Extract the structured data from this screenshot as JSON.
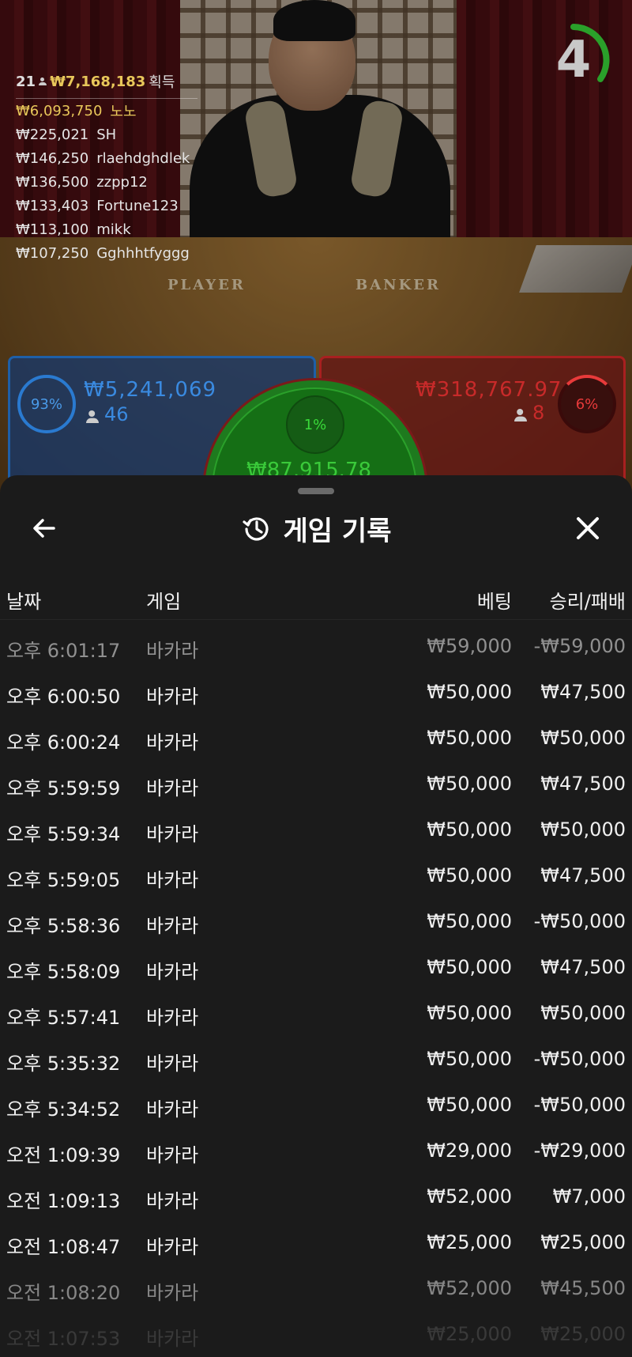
{
  "live": {
    "leaderboard": {
      "count": "21",
      "total": "₩7,168,183",
      "won_label": "획득",
      "entries": [
        {
          "amount": "₩6,093,750",
          "name": "노노"
        },
        {
          "amount": "₩225,021",
          "name": "SH"
        },
        {
          "amount": "₩146,250",
          "name": "rlaehdghdlek"
        },
        {
          "amount": "₩136,500",
          "name": "zzpp12"
        },
        {
          "amount": "₩133,403",
          "name": "Fortune123"
        },
        {
          "amount": "₩113,100",
          "name": "mikk"
        },
        {
          "amount": "₩107,250",
          "name": "Gghhhtfyggg"
        }
      ]
    },
    "timer": "4",
    "table_labels": {
      "player": "PLAYER",
      "banker": "BANKER"
    },
    "bets": {
      "player": {
        "percent": "93%",
        "amount": "₩5,241,069",
        "players": "46"
      },
      "banker": {
        "percent": "6%",
        "amount": "₩318,767.97",
        "players": "8"
      },
      "tie": {
        "percent": "1%",
        "amount": "₩87,915.78"
      }
    },
    "colors": {
      "player": "#1e5fa8",
      "banker": "#a82020",
      "tie": "#1e7a1e",
      "gold": "#e8c75a"
    }
  },
  "sheet": {
    "title": "게임 기록",
    "icons": {
      "back": "arrow-left-icon",
      "history": "history-icon",
      "close": "close-icon"
    },
    "columns": {
      "date": "날짜",
      "game": "게임",
      "bet": "베팅",
      "result": "승리/패배"
    },
    "rows": [
      {
        "date": "오후 6:01:17",
        "game": "바카라",
        "bet": "₩59,000",
        "result": "-₩59,000"
      },
      {
        "date": "오후 6:00:50",
        "game": "바카라",
        "bet": "₩50,000",
        "result": "₩47,500"
      },
      {
        "date": "오후 6:00:24",
        "game": "바카라",
        "bet": "₩50,000",
        "result": "₩50,000"
      },
      {
        "date": "오후 5:59:59",
        "game": "바카라",
        "bet": "₩50,000",
        "result": "₩47,500"
      },
      {
        "date": "오후 5:59:34",
        "game": "바카라",
        "bet": "₩50,000",
        "result": "₩50,000"
      },
      {
        "date": "오후 5:59:05",
        "game": "바카라",
        "bet": "₩50,000",
        "result": "₩47,500"
      },
      {
        "date": "오후 5:58:36",
        "game": "바카라",
        "bet": "₩50,000",
        "result": "-₩50,000"
      },
      {
        "date": "오후 5:58:09",
        "game": "바카라",
        "bet": "₩50,000",
        "result": "₩47,500"
      },
      {
        "date": "오후 5:57:41",
        "game": "바카라",
        "bet": "₩50,000",
        "result": "₩50,000"
      },
      {
        "date": "오후 5:35:32",
        "game": "바카라",
        "bet": "₩50,000",
        "result": "-₩50,000"
      },
      {
        "date": "오후 5:34:52",
        "game": "바카라",
        "bet": "₩50,000",
        "result": "-₩50,000"
      },
      {
        "date": "오전 1:09:39",
        "game": "바카라",
        "bet": "₩29,000",
        "result": "-₩29,000"
      },
      {
        "date": "오전 1:09:13",
        "game": "바카라",
        "bet": "₩52,000",
        "result": "₩7,000"
      },
      {
        "date": "오전 1:08:47",
        "game": "바카라",
        "bet": "₩25,000",
        "result": "₩25,000"
      },
      {
        "date": "오전 1:08:20",
        "game": "바카라",
        "bet": "₩52,000",
        "result": "₩45,500"
      },
      {
        "date": "오전 1:07:53",
        "game": "바카라",
        "bet": "₩25,000",
        "result": "₩25,000"
      }
    ]
  }
}
